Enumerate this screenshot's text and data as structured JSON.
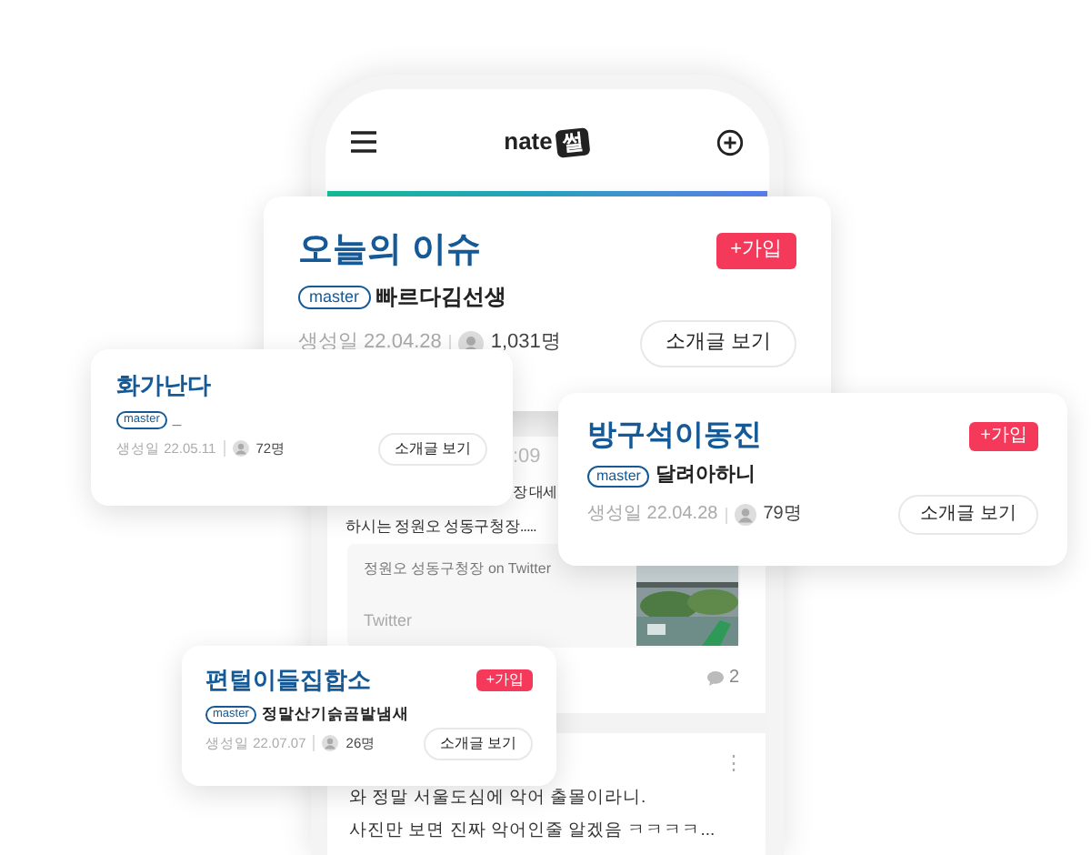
{
  "phone": {
    "header": {
      "logo_text": "nate",
      "logo_badge": "썰"
    },
    "post_1": {
      "time": ":09",
      "text_fragment": "장 대세",
      "text": "하시는 정원오 성동구청장.....",
      "link_card": {
        "title": "정원오 성동구청장 on Twitter",
        "source": "Twitter"
      },
      "comment_count": "2"
    },
    "post_2": {
      "more": "⋮",
      "lines": [
        "와 정말 서울도심에 악어 출몰이라니.",
        "사진만 보면 진짜 악어인줄 알겠음 ㅋㅋㅋㅋ..."
      ]
    }
  },
  "cards": [
    {
      "title": "오늘의 이슈",
      "join": "+가입",
      "master_badge": "master",
      "master": "빠르다김선생",
      "created": "생성일 22.04.28",
      "members": "1,031명",
      "intro": "소개글 보기"
    },
    {
      "title": "화가난다",
      "master_badge": "master",
      "master": "_",
      "created": "생성일 22.05.11",
      "members": "72명",
      "intro": "소개글 보기"
    },
    {
      "title": "방구석이동진",
      "join": "+가입",
      "master_badge": "master",
      "master": "달려아하니",
      "created": "생성일 22.04.28",
      "members": "79명",
      "intro": "소개글 보기"
    },
    {
      "title": "편털이들집합소",
      "join": "+가입",
      "master_badge": "master",
      "master": "정말산기슭곰발냄새",
      "created": "생성일 22.07.07",
      "members": "26명",
      "intro": "소개글 보기"
    }
  ]
}
